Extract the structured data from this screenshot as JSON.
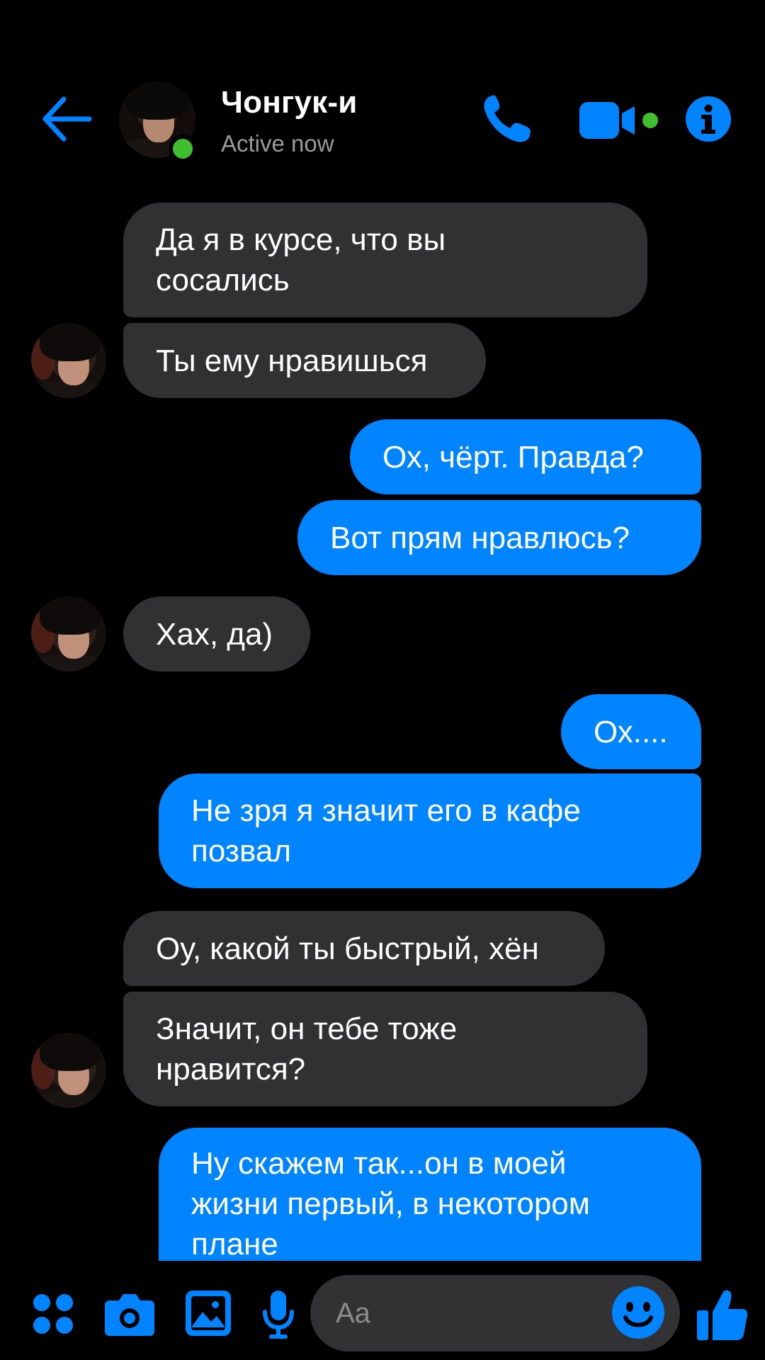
{
  "colors": {
    "accent": "#0084ff",
    "incoming_bubble": "#313033",
    "online": "#3fbf30",
    "background": "#000000"
  },
  "header": {
    "back_icon": "arrow-left-icon",
    "contact_name": "Чонгук-и",
    "status": "Active now",
    "actions": [
      "phone-icon",
      "video-camera-icon",
      "info-icon"
    ]
  },
  "messages": [
    {
      "dir": "in",
      "lines": [
        "Да я в курсе, что вы",
        "сосались"
      ]
    },
    {
      "dir": "in",
      "lines": [
        "Ты ему нравишься"
      ]
    },
    {
      "dir": "out",
      "lines": [
        "Ох, чёрт. Правда?"
      ]
    },
    {
      "dir": "out",
      "lines": [
        "Вот прям нравлюсь?"
      ]
    },
    {
      "dir": "in",
      "lines": [
        "Хах, да)"
      ]
    },
    {
      "dir": "out",
      "lines": [
        "Ох...."
      ]
    },
    {
      "dir": "out",
      "lines": [
        "Не зря я значит его в кафе",
        "позвал"
      ]
    },
    {
      "dir": "in",
      "lines": [
        "Оу, какой ты быстрый, хён"
      ]
    },
    {
      "dir": "in",
      "lines": [
        "Значит, он тебе тоже",
        "нравится?"
      ]
    },
    {
      "dir": "out",
      "lines": [
        "Ну скажем так...он в моей",
        "жизни первый, в некотором",
        "плане"
      ]
    }
  ],
  "composer": {
    "tools": [
      "apps-grid-icon",
      "camera-icon",
      "gallery-icon",
      "microphone-icon"
    ],
    "placeholder": "Aa",
    "emoji_icon": "smiley-icon",
    "like_icon": "thumbs-up-icon"
  }
}
